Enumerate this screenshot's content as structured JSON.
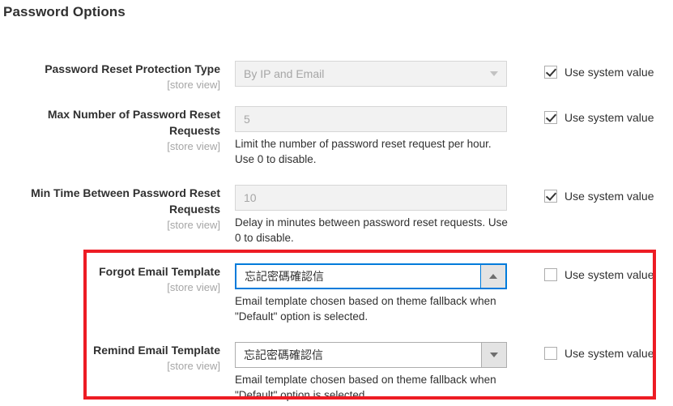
{
  "section": {
    "title": "Password Options"
  },
  "fields": [
    {
      "label": "Password Reset Protection Type",
      "scope": "[store view]",
      "control_type": "select",
      "value": "By IP and Email",
      "disabled": true,
      "focused": false,
      "caret": "chevron-down-icon",
      "note": "",
      "system_value": {
        "label": "Use system value",
        "checked": true
      }
    },
    {
      "label": "Max Number of Password Reset Requests",
      "scope": "[store view]",
      "control_type": "text",
      "value": "5",
      "disabled": true,
      "focused": false,
      "caret": "",
      "note": "Limit the number of password reset request per hour. Use 0 to disable.",
      "system_value": {
        "label": "Use system value",
        "checked": true
      }
    },
    {
      "label": "Min Time Between Password Reset Requests",
      "scope": "[store view]",
      "control_type": "text",
      "value": "10",
      "disabled": true,
      "focused": false,
      "caret": "",
      "note": "Delay in minutes between password reset requests. Use 0 to disable.",
      "system_value": {
        "label": "Use system value",
        "checked": true
      }
    },
    {
      "label": "Forgot Email Template",
      "scope": "[store view]",
      "control_type": "select",
      "value": "忘記密碼確認信",
      "disabled": false,
      "focused": true,
      "caret": "chevron-up-icon",
      "note": "Email template chosen based on theme fallback when \"Default\" option is selected.",
      "system_value": {
        "label": "Use system value",
        "checked": false
      }
    },
    {
      "label": "Remind Email Template",
      "scope": "[store view]",
      "control_type": "select",
      "value": "忘記密碼確認信",
      "disabled": false,
      "focused": false,
      "caret": "chevron-down-icon",
      "note": "Email template chosen based on theme fallback when \"Default\" option is selected.",
      "system_value": {
        "label": "Use system value",
        "checked": false
      }
    }
  ],
  "highlight": {
    "name": "email-template-highlight",
    "color": "#ed1c24"
  },
  "colors": {
    "accent_focus": "#007bdb",
    "highlight": "#ed1c24",
    "text": "#303030",
    "muted": "#a6a6a6"
  }
}
